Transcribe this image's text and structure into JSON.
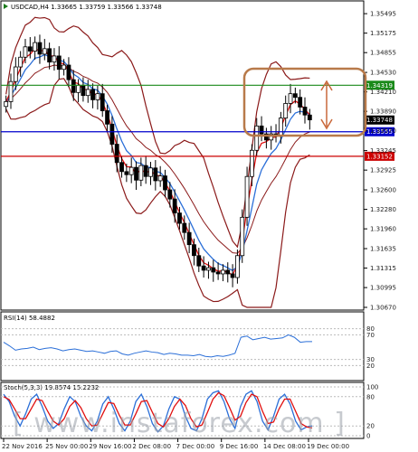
{
  "chart_data": {
    "type": "candlestick",
    "header": "USDCAD,H4  1.33665 1.33759 1.33566 1.33748",
    "price_axis": {
      "ticks": [
        "1.35495",
        "1.35175",
        "1.34855",
        "1.34530",
        "1.34210",
        "1.33890",
        "1.33570",
        "1.33245",
        "1.32925",
        "1.32600",
        "1.32280",
        "1.31960",
        "1.31635",
        "1.31315",
        "1.30995",
        "1.30670"
      ],
      "ylim": [
        1.3067,
        1.3566
      ]
    },
    "time_axis": {
      "ticks": [
        "22 Nov 2016",
        "25 Nov 00:00",
        "29 Nov 16:00",
        "2 Dec 08:00",
        "7 Dec 00:00",
        "9 Dec 16:00",
        "14 Dec 08:00",
        "19 Dec 00:00"
      ]
    },
    "horizontal_levels": [
      {
        "value": 1.34319,
        "label": "1.34319",
        "color": "#1a8a1a"
      },
      {
        "value": 1.33748,
        "label": "1.33748",
        "color": "#000000"
      },
      {
        "value": 1.33555,
        "label": "1.33555",
        "color": "#0000cc"
      },
      {
        "value": 1.33152,
        "label": "1.33152",
        "color": "#cc0000"
      }
    ],
    "closes": [
      1.3405,
      1.3438,
      1.3462,
      1.3478,
      1.3495,
      1.3488,
      1.3502,
      1.3483,
      1.3492,
      1.347,
      1.348,
      1.3458,
      1.3465,
      1.3441,
      1.342,
      1.3432,
      1.3415,
      1.3425,
      1.3408,
      1.3418,
      1.339,
      1.3368,
      1.3335,
      1.3305,
      1.329,
      1.3285,
      1.3297,
      1.3276,
      1.33,
      1.3282,
      1.3296,
      1.3275,
      1.3283,
      1.326,
      1.3245,
      1.3222,
      1.3205,
      1.319,
      1.317,
      1.3152,
      1.3135,
      1.3128,
      1.3132,
      1.3125,
      1.3122,
      1.3128,
      1.3122,
      1.3116,
      1.3152,
      1.3215,
      1.3282,
      1.3325,
      1.3365,
      1.3352,
      1.3342,
      1.3352,
      1.3348,
      1.3378,
      1.3402,
      1.3418,
      1.3412,
      1.3396,
      1.3383,
      1.3375
    ],
    "rsi": {
      "label": "RSI(14) 58.4882",
      "ticks": [
        "80",
        "70",
        "30",
        "20"
      ],
      "ylim": [
        0,
        100
      ],
      "values": [
        58,
        52,
        45,
        47,
        48,
        50,
        46,
        48,
        49,
        47,
        44,
        46,
        47,
        45,
        43,
        44,
        42,
        40,
        43,
        44,
        39,
        37,
        40,
        42,
        44,
        42,
        41,
        38,
        40,
        39,
        37,
        37,
        36,
        38,
        35,
        34,
        36,
        35,
        37,
        40,
        66,
        68,
        62,
        64,
        66,
        63,
        64,
        65,
        70,
        66,
        58,
        59,
        59
      ]
    },
    "stochastic": {
      "label": "Stoch(5,3,3) 19.8574 15.2232",
      "ticks": [
        "100",
        "80",
        "20",
        "0"
      ],
      "ylim": [
        0,
        100
      ],
      "main": [
        85,
        70,
        40,
        20,
        45,
        75,
        85,
        60,
        30,
        15,
        25,
        55,
        80,
        70,
        40,
        20,
        10,
        30,
        65,
        80,
        55,
        25,
        10,
        30,
        70,
        85,
        60,
        25,
        8,
        20,
        55,
        80,
        75,
        40,
        15,
        10,
        35,
        75,
        88,
        92,
        70,
        35,
        15,
        60,
        85,
        92,
        70,
        30,
        12,
        40,
        75,
        85,
        65,
        30,
        12,
        18,
        20
      ],
      "signal": [
        80,
        74,
        55,
        35,
        35,
        55,
        75,
        72,
        50,
        30,
        22,
        35,
        60,
        72,
        58,
        35,
        20,
        22,
        45,
        68,
        66,
        42,
        22,
        22,
        45,
        70,
        72,
        48,
        25,
        18,
        35,
        60,
        75,
        62,
        35,
        18,
        22,
        48,
        75,
        88,
        82,
        58,
        32,
        40,
        68,
        85,
        80,
        50,
        25,
        28,
        55,
        75,
        75,
        50,
        25,
        18,
        16
      ]
    }
  },
  "watermark": "[ www.instaforex.com ]"
}
